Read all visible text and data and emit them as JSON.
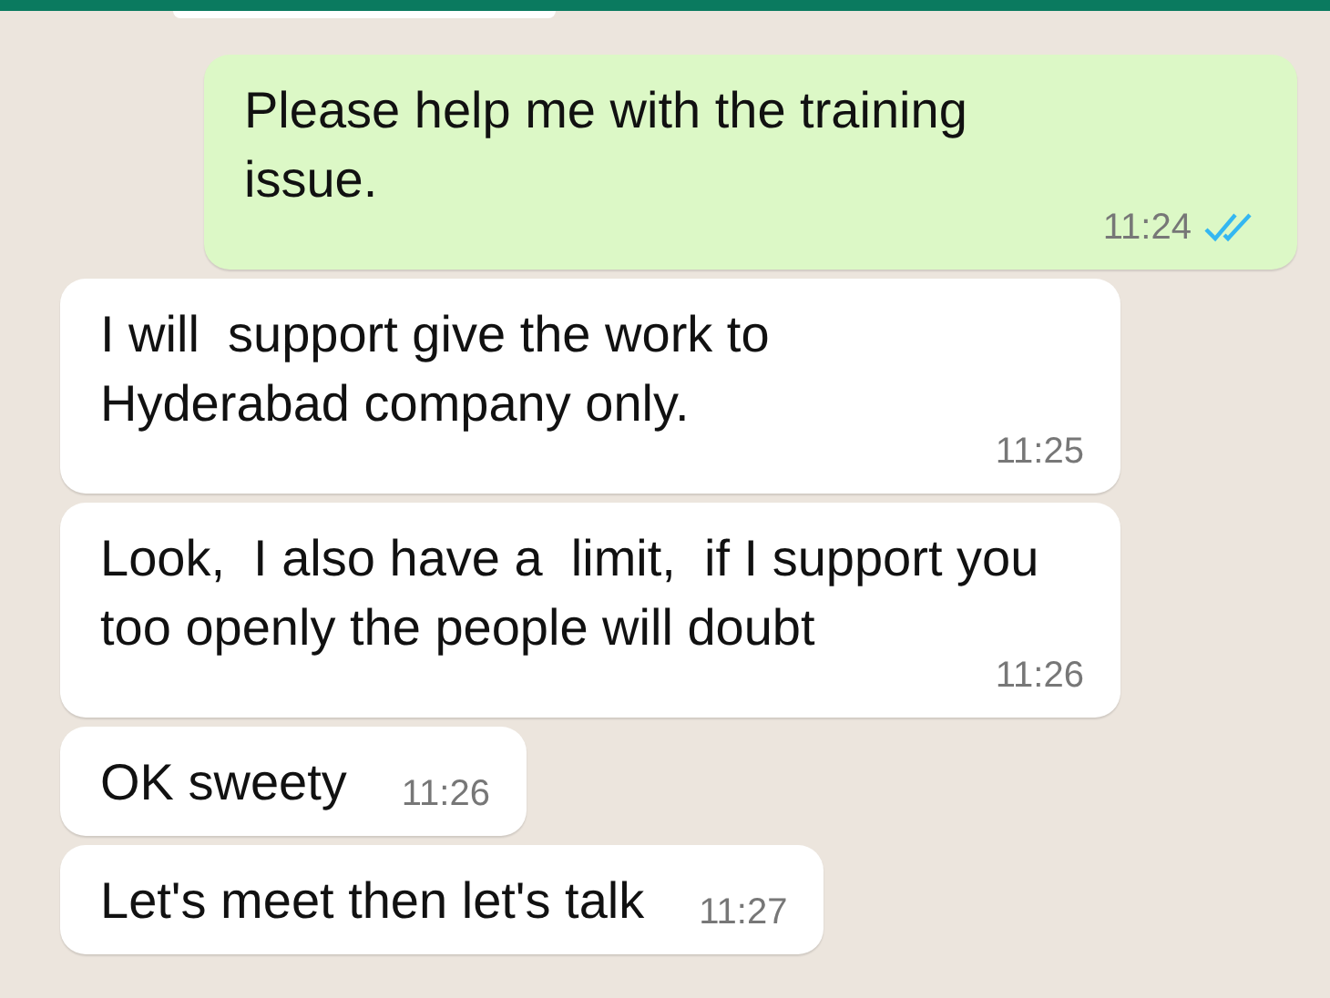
{
  "messages": [
    {
      "kind": "sent",
      "text": "Please help me with the training issue.",
      "time": "11:24",
      "read": true
    },
    {
      "kind": "received",
      "text": "I will  support give the work to Hyderabad company only.",
      "time": "11:25"
    },
    {
      "kind": "received",
      "text": "Look,  I also have a  limit,  if I support you too openly the people will doubt",
      "time": "11:26"
    },
    {
      "kind": "received",
      "text": "OK sweety",
      "time": "11:26"
    },
    {
      "kind": "received",
      "text": "Let's meet then let's talk",
      "time": "11:27"
    }
  ]
}
